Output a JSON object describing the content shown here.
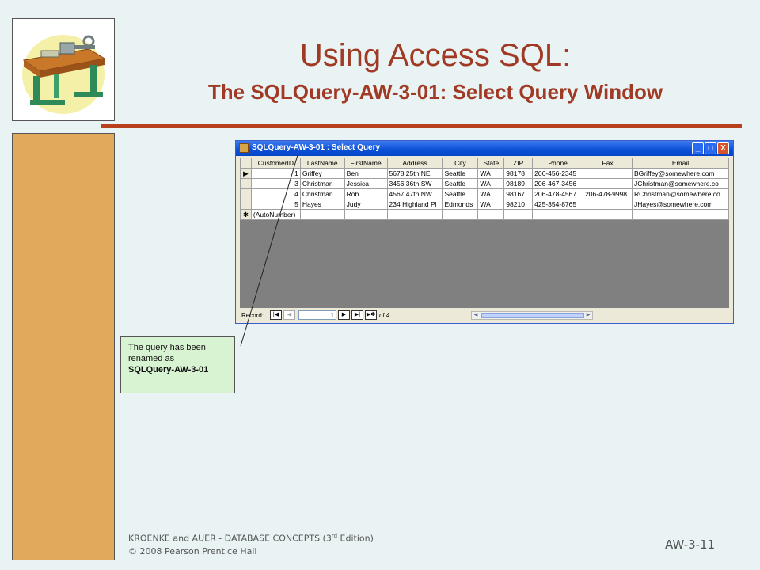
{
  "slide": {
    "title": "Using Access SQL:",
    "subtitle": "The SQLQuery-AW-3-01: Select Query Window",
    "colors": {
      "title": "#a03a24",
      "rule": "#b8401c",
      "sidebar": "#e0a95c",
      "background": "#e9f3f3",
      "callout": "#d8f3d2"
    },
    "logo_icon": "workbench-icon"
  },
  "window": {
    "title": "SQLQuery-AW-3-01 : Select Query",
    "buttons": {
      "minimize": "_",
      "maximize": "□",
      "close": "X"
    },
    "columns": [
      "CustomerID",
      "LastName",
      "FirstName",
      "Address",
      "City",
      "State",
      "ZIP",
      "Phone",
      "Fax",
      "Email"
    ],
    "rows": [
      {
        "selector": "▶",
        "cells": [
          "1",
          "Griffey",
          "Ben",
          "5678 25th NE",
          "Seattle",
          "WA",
          "98178",
          "206-456-2345",
          "",
          "BGriffey@somewhere.com"
        ]
      },
      {
        "selector": "",
        "cells": [
          "3",
          "Christman",
          "Jessica",
          "3456 36th SW",
          "Seattle",
          "WA",
          "98189",
          "206-467-3456",
          "",
          "JChristman@somewhere.co"
        ]
      },
      {
        "selector": "",
        "cells": [
          "4",
          "Christman",
          "Rob",
          "4567 47th NW",
          "Seattle",
          "WA",
          "98167",
          "206-478-4567",
          "206-478-9998",
          "RChristman@somewhere.co"
        ]
      },
      {
        "selector": "",
        "cells": [
          "5",
          "Hayes",
          "Judy",
          "234 Highland Pl",
          "Edmonds",
          "WA",
          "98210",
          "425-354-8765",
          "",
          "JHayes@somewhere.com"
        ]
      },
      {
        "selector": "✱",
        "cells": [
          "(AutoNumber)",
          "",
          "",
          "",
          "",
          "",
          "",
          "",
          "",
          ""
        ]
      }
    ],
    "record_nav": {
      "label": "Record:",
      "first": "|◀",
      "prev": "◀",
      "current": "1",
      "next": "▶",
      "last": "▶|",
      "new": "▶✱",
      "of_text": "of 4"
    }
  },
  "callout": {
    "text": "The query has been renamed as",
    "emphasis": "SQLQuery-AW-3-01"
  },
  "footer": {
    "line1_prefix": "KROENKE and AUER -  DATABASE CONCEPTS (3",
    "line1_sup": "rd",
    "line1_suffix": " Edition)",
    "line2": "© 2008 Pearson Prentice Hall",
    "page": "AW-3-11"
  }
}
